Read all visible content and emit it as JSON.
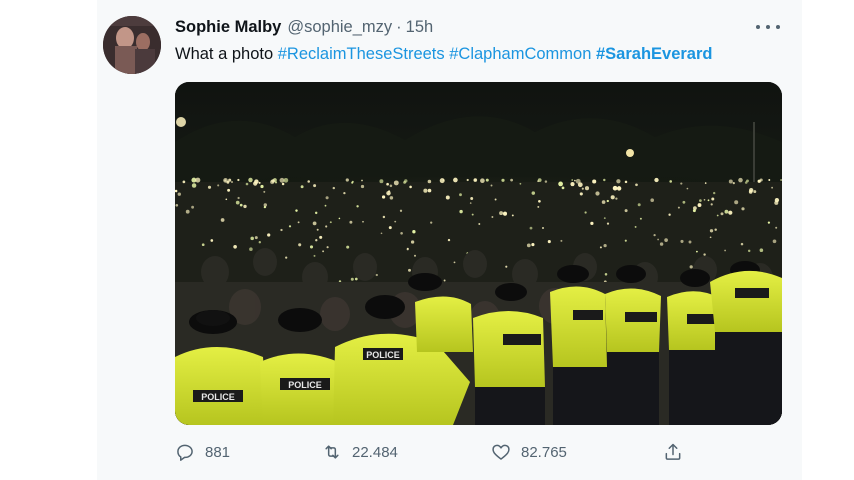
{
  "tweet": {
    "author_name": "Sophie Malby",
    "handle": "@sophie_mzy",
    "separator": "·",
    "time": "15h",
    "text_plain": "What a photo ",
    "hashtags": [
      "#ReclaimTheseStreets",
      "#ClaphamCommon",
      "#SarahEverard"
    ],
    "photo": {
      "police_label": "POLICE"
    },
    "actions": {
      "reply_count": "881",
      "retweet_count": "22.484",
      "like_count": "82.765"
    }
  },
  "icons": {
    "more": "more-horizontal-icon",
    "reply": "reply-icon",
    "retweet": "retweet-icon",
    "like": "heart-icon",
    "share": "share-icon"
  },
  "colors": {
    "hashtag": "#1b95e0",
    "secondary_text": "#536471",
    "card_background": "#f7f9fa",
    "police_vest": "#d6e629"
  }
}
